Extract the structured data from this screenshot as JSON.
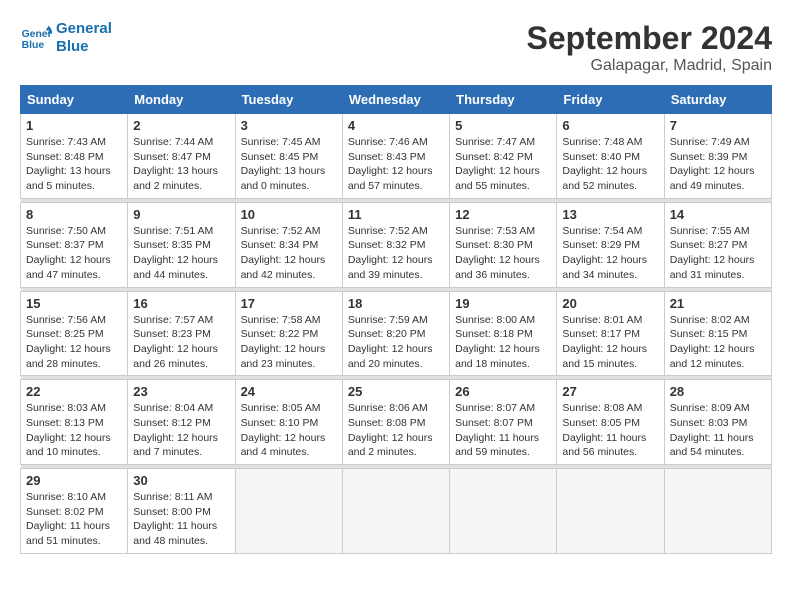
{
  "logo": {
    "line1": "General",
    "line2": "Blue"
  },
  "title": "September 2024",
  "location": "Galapagar, Madrid, Spain",
  "weekdays": [
    "Sunday",
    "Monday",
    "Tuesday",
    "Wednesday",
    "Thursday",
    "Friday",
    "Saturday"
  ],
  "weeks": [
    [
      {
        "day": "1",
        "sunrise": "7:43 AM",
        "sunset": "8:48 PM",
        "daylight": "13 hours and 5 minutes."
      },
      {
        "day": "2",
        "sunrise": "7:44 AM",
        "sunset": "8:47 PM",
        "daylight": "13 hours and 2 minutes."
      },
      {
        "day": "3",
        "sunrise": "7:45 AM",
        "sunset": "8:45 PM",
        "daylight": "13 hours and 0 minutes."
      },
      {
        "day": "4",
        "sunrise": "7:46 AM",
        "sunset": "8:43 PM",
        "daylight": "12 hours and 57 minutes."
      },
      {
        "day": "5",
        "sunrise": "7:47 AM",
        "sunset": "8:42 PM",
        "daylight": "12 hours and 55 minutes."
      },
      {
        "day": "6",
        "sunrise": "7:48 AM",
        "sunset": "8:40 PM",
        "daylight": "12 hours and 52 minutes."
      },
      {
        "day": "7",
        "sunrise": "7:49 AM",
        "sunset": "8:39 PM",
        "daylight": "12 hours and 49 minutes."
      }
    ],
    [
      {
        "day": "8",
        "sunrise": "7:50 AM",
        "sunset": "8:37 PM",
        "daylight": "12 hours and 47 minutes."
      },
      {
        "day": "9",
        "sunrise": "7:51 AM",
        "sunset": "8:35 PM",
        "daylight": "12 hours and 44 minutes."
      },
      {
        "day": "10",
        "sunrise": "7:52 AM",
        "sunset": "8:34 PM",
        "daylight": "12 hours and 42 minutes."
      },
      {
        "day": "11",
        "sunrise": "7:52 AM",
        "sunset": "8:32 PM",
        "daylight": "12 hours and 39 minutes."
      },
      {
        "day": "12",
        "sunrise": "7:53 AM",
        "sunset": "8:30 PM",
        "daylight": "12 hours and 36 minutes."
      },
      {
        "day": "13",
        "sunrise": "7:54 AM",
        "sunset": "8:29 PM",
        "daylight": "12 hours and 34 minutes."
      },
      {
        "day": "14",
        "sunrise": "7:55 AM",
        "sunset": "8:27 PM",
        "daylight": "12 hours and 31 minutes."
      }
    ],
    [
      {
        "day": "15",
        "sunrise": "7:56 AM",
        "sunset": "8:25 PM",
        "daylight": "12 hours and 28 minutes."
      },
      {
        "day": "16",
        "sunrise": "7:57 AM",
        "sunset": "8:23 PM",
        "daylight": "12 hours and 26 minutes."
      },
      {
        "day": "17",
        "sunrise": "7:58 AM",
        "sunset": "8:22 PM",
        "daylight": "12 hours and 23 minutes."
      },
      {
        "day": "18",
        "sunrise": "7:59 AM",
        "sunset": "8:20 PM",
        "daylight": "12 hours and 20 minutes."
      },
      {
        "day": "19",
        "sunrise": "8:00 AM",
        "sunset": "8:18 PM",
        "daylight": "12 hours and 18 minutes."
      },
      {
        "day": "20",
        "sunrise": "8:01 AM",
        "sunset": "8:17 PM",
        "daylight": "12 hours and 15 minutes."
      },
      {
        "day": "21",
        "sunrise": "8:02 AM",
        "sunset": "8:15 PM",
        "daylight": "12 hours and 12 minutes."
      }
    ],
    [
      {
        "day": "22",
        "sunrise": "8:03 AM",
        "sunset": "8:13 PM",
        "daylight": "12 hours and 10 minutes."
      },
      {
        "day": "23",
        "sunrise": "8:04 AM",
        "sunset": "8:12 PM",
        "daylight": "12 hours and 7 minutes."
      },
      {
        "day": "24",
        "sunrise": "8:05 AM",
        "sunset": "8:10 PM",
        "daylight": "12 hours and 4 minutes."
      },
      {
        "day": "25",
        "sunrise": "8:06 AM",
        "sunset": "8:08 PM",
        "daylight": "12 hours and 2 minutes."
      },
      {
        "day": "26",
        "sunrise": "8:07 AM",
        "sunset": "8:07 PM",
        "daylight": "11 hours and 59 minutes."
      },
      {
        "day": "27",
        "sunrise": "8:08 AM",
        "sunset": "8:05 PM",
        "daylight": "11 hours and 56 minutes."
      },
      {
        "day": "28",
        "sunrise": "8:09 AM",
        "sunset": "8:03 PM",
        "daylight": "11 hours and 54 minutes."
      }
    ],
    [
      {
        "day": "29",
        "sunrise": "8:10 AM",
        "sunset": "8:02 PM",
        "daylight": "11 hours and 51 minutes."
      },
      {
        "day": "30",
        "sunrise": "8:11 AM",
        "sunset": "8:00 PM",
        "daylight": "11 hours and 48 minutes."
      },
      null,
      null,
      null,
      null,
      null
    ]
  ],
  "labels": {
    "sunrise": "Sunrise:",
    "sunset": "Sunset:",
    "daylight": "Daylight:"
  }
}
